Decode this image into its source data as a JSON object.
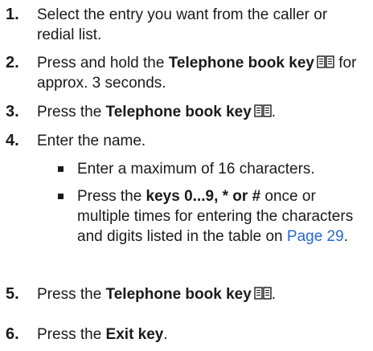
{
  "steps": [
    {
      "number": "1.",
      "text": "Select the entry you want from the caller or redial list."
    },
    {
      "number": "2.",
      "pre": "Press and hold the ",
      "bold": "Telephone book key",
      "post": " for approx. 3 seconds.",
      "icon": "phonebook-icon"
    },
    {
      "number": "3.",
      "pre": "Press the ",
      "bold": "Telephone book key",
      "post": ".",
      "icon": "phonebook-icon"
    },
    {
      "number": "4.",
      "text": "Enter the name.",
      "bullets": [
        {
          "text": "Enter a maximum of 16 characters."
        },
        {
          "pre": "Press the ",
          "bold": "keys 0...9, * or #",
          "mid": " once or multiple times for entering the characters and digits listed in the table on ",
          "link": "Page 29",
          "post": "."
        }
      ]
    },
    {
      "number": "5.",
      "pre": "Press the ",
      "bold": "Telephone book key",
      "post": ".",
      "icon": "phonebook-icon"
    },
    {
      "number": "6.",
      "pre": "Press the ",
      "bold": "Exit key",
      "post": "."
    }
  ],
  "colors": {
    "text": "#1a1a1a",
    "link": "#2a66d9"
  }
}
